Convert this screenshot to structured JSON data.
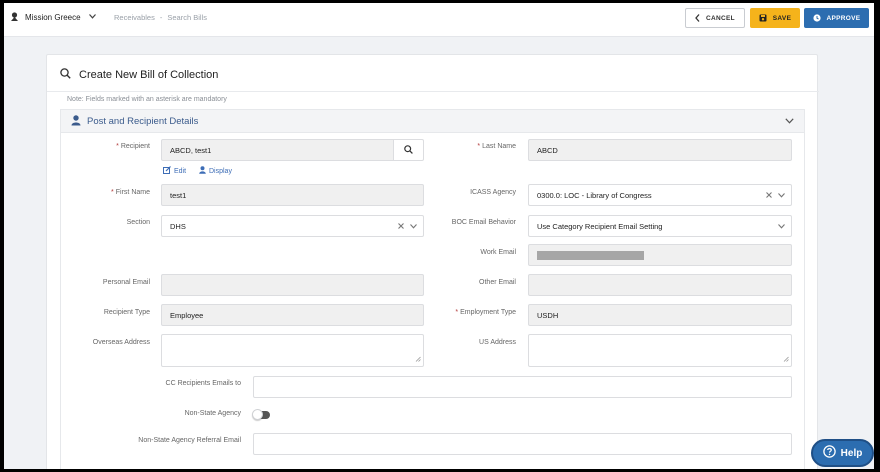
{
  "topbar": {
    "brand": "Mission Greece",
    "breadcrumb": {
      "item1": "Receivables",
      "separator": "-",
      "item2": "Search Bills"
    },
    "buttons": {
      "cancel": "CANCEL",
      "save": "SAVE",
      "approve": "APPROVE"
    }
  },
  "page": {
    "title": "Create New Bill of Collection",
    "note": "Note: Fields marked with an asterisk are mandatory"
  },
  "section": {
    "title": "Post and Recipient Details"
  },
  "form": {
    "recipient": {
      "label": "Recipient",
      "value": "ABCD, test1",
      "edit_link": "Edit",
      "display_link": "Display"
    },
    "last_name": {
      "label": "Last Name",
      "value": "ABCD"
    },
    "first_name": {
      "label": "First Name",
      "value": "test1"
    },
    "icass_agency": {
      "label": "ICASS Agency",
      "value": "0300.0: LOC - Library of Congress"
    },
    "section": {
      "label": "Section",
      "value": "DHS"
    },
    "boc_email_behavior": {
      "label": "BOC Email Behavior",
      "value": "Use Category Recipient Email Setting"
    },
    "work_email": {
      "label": "Work Email",
      "value": ""
    },
    "personal_email": {
      "label": "Personal Email",
      "value": ""
    },
    "other_email": {
      "label": "Other Email",
      "value": ""
    },
    "recipient_type": {
      "label": "Recipient Type",
      "value": "Employee"
    },
    "employment_type": {
      "label": "Employment Type",
      "value": "USDH"
    },
    "overseas_address": {
      "label": "Overseas Address",
      "value": ""
    },
    "us_address": {
      "label": "US Address",
      "value": ""
    },
    "cc_emails": {
      "label": "CC Recipients Emails to",
      "value": ""
    },
    "non_state_agency": {
      "label": "Non-State Agency",
      "value": false
    },
    "non_state_referral_email": {
      "label": "Non-State Agency Referral Email",
      "value": ""
    }
  },
  "help": {
    "label": "Help"
  },
  "colors": {
    "save": "#f5b31b",
    "approve": "#2c6db0",
    "section_title": "#3b5b8c",
    "required": "#b23a3a"
  }
}
